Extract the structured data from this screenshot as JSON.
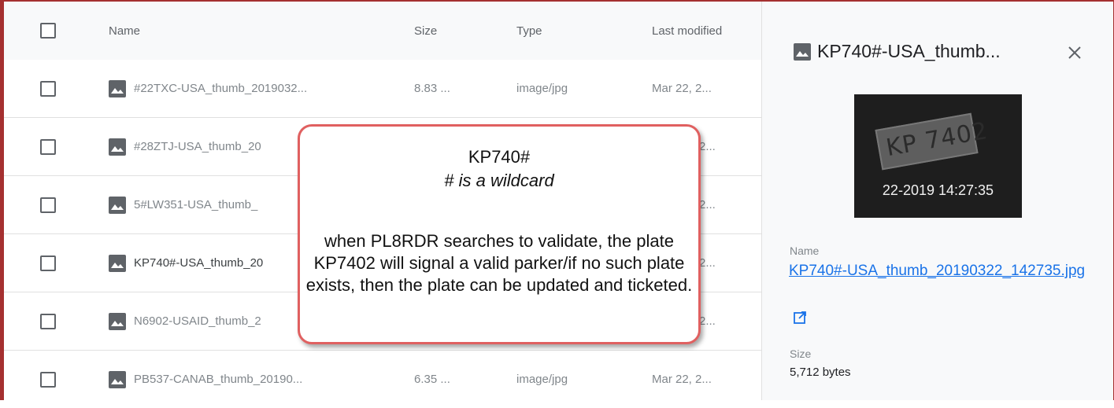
{
  "table": {
    "headers": {
      "name": "Name",
      "size": "Size",
      "type": "Type",
      "modified": "Last modified"
    },
    "rows": [
      {
        "name": "#22TXC-USA_thumb_2019032...",
        "size": "8.83 ...",
        "type": "image/jpg",
        "modified": "Mar 22, 2..."
      },
      {
        "name": "#28ZTJ-USA_thumb_20",
        "size": "",
        "type": "",
        "modified": "2..."
      },
      {
        "name": "5#LW351-USA_thumb_",
        "size": "",
        "type": "",
        "modified": "2..."
      },
      {
        "name": "KP740#-USA_thumb_20",
        "size": "",
        "type": "",
        "modified": "2..."
      },
      {
        "name": "N6902-USAID_thumb_2",
        "size": "",
        "type": "",
        "modified": "2..."
      },
      {
        "name": "PB537-CANAB_thumb_20190...",
        "size": "6.35 ...",
        "type": "image/jpg",
        "modified": "Mar 22, 2..."
      }
    ]
  },
  "panel": {
    "title": "KP740#-USA_thumb...",
    "thumbnail": {
      "plate_text": "KP 7402",
      "timestamp": "22-2019 14:27:35"
    },
    "name_label": "Name",
    "name_value": "KP740#-USA_thumb_20190322_142735.jpg",
    "size_label": "Size",
    "size_value": "5,712 bytes"
  },
  "callout": {
    "line1": "KP740#",
    "line2": "# is a wildcard",
    "body": "when PL8RDR searches to validate, the plate KP7402 will signal a valid parker/if no such plate exists, then the plate can be updated and ticketed."
  },
  "colors": {
    "accent": "#1a73e8",
    "frame": "#a53030",
    "callout_border": "#e06060"
  },
  "icons": [
    "checkbox",
    "image-icon",
    "close-icon",
    "open-in-new-icon"
  ]
}
